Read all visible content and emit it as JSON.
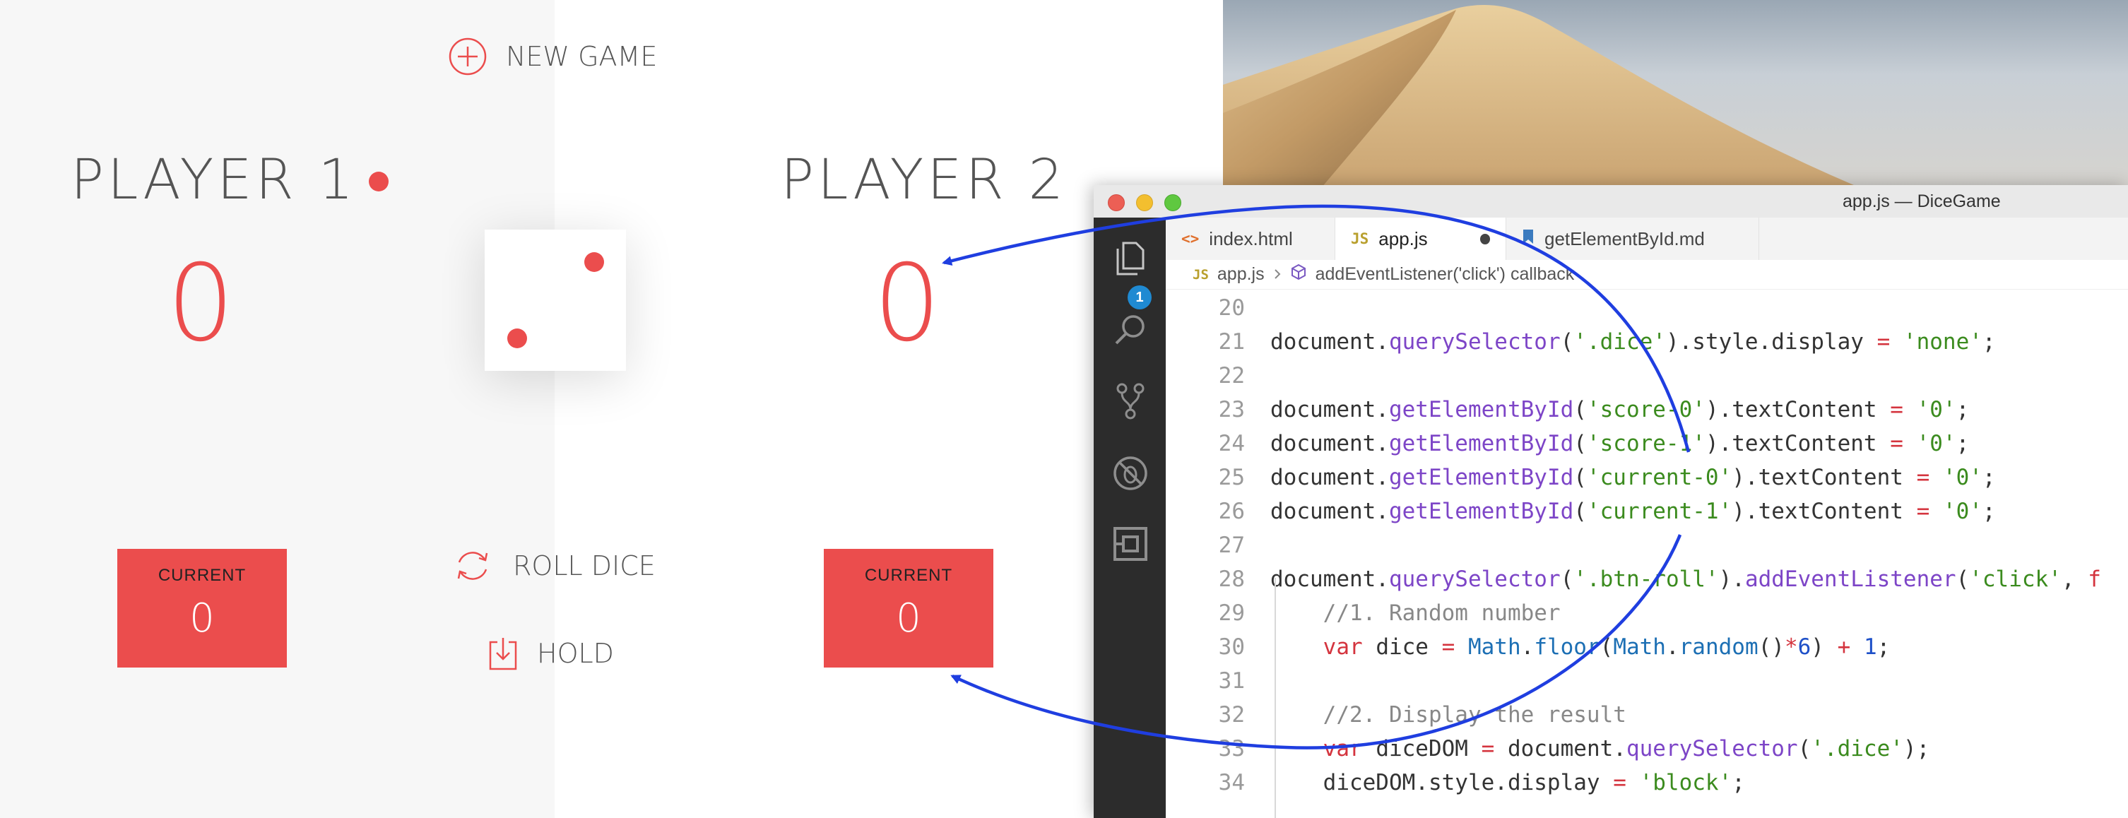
{
  "game": {
    "new_game_label": "NEW GAME",
    "players": [
      {
        "name": "PLAYER 1",
        "score": "0",
        "current_label": "CURRENT",
        "current_value": "0",
        "active": true
      },
      {
        "name": "PLAYER 2",
        "score": "0",
        "current_label": "CURRENT",
        "current_value": "0",
        "active": false
      }
    ],
    "roll_label": "ROLL DICE",
    "hold_label": "HOLD",
    "dice_value": 2,
    "accent_color": "#eb4d4d"
  },
  "editor": {
    "window_title": "app.js — DiceGame",
    "explorer_badge": "1",
    "tabs": [
      {
        "icon": "<>",
        "label": "index.html"
      },
      {
        "icon": "JS",
        "label": "app.js",
        "modified": true
      },
      {
        "icon": "markdown-icon",
        "label": "getElementById.md"
      }
    ],
    "breadcrumb": {
      "file_icon": "JS",
      "file": "app.js",
      "symbol": "addEventListener('click') callback"
    },
    "code_lines": [
      {
        "num": "20",
        "tokens": []
      },
      {
        "num": "21",
        "tokens": [
          {
            "t": "document.",
            "c": ""
          },
          {
            "t": "querySelector",
            "c": "fn"
          },
          {
            "t": "(",
            "c": ""
          },
          {
            "t": "'.dice'",
            "c": "str"
          },
          {
            "t": ").style.display ",
            "c": ""
          },
          {
            "t": "=",
            "c": "kw"
          },
          {
            "t": " ",
            "c": ""
          },
          {
            "t": "'none'",
            "c": "str"
          },
          {
            "t": ";",
            "c": ""
          }
        ]
      },
      {
        "num": "22",
        "tokens": []
      },
      {
        "num": "23",
        "tokens": [
          {
            "t": "document.",
            "c": ""
          },
          {
            "t": "getElementById",
            "c": "fn"
          },
          {
            "t": "(",
            "c": ""
          },
          {
            "t": "'score-0'",
            "c": "str"
          },
          {
            "t": ").textContent ",
            "c": ""
          },
          {
            "t": "=",
            "c": "kw"
          },
          {
            "t": " ",
            "c": ""
          },
          {
            "t": "'0'",
            "c": "str"
          },
          {
            "t": ";",
            "c": ""
          }
        ]
      },
      {
        "num": "24",
        "tokens": [
          {
            "t": "document.",
            "c": ""
          },
          {
            "t": "getElementById",
            "c": "fn"
          },
          {
            "t": "(",
            "c": ""
          },
          {
            "t": "'score-1'",
            "c": "str"
          },
          {
            "t": ").textContent ",
            "c": ""
          },
          {
            "t": "=",
            "c": "kw"
          },
          {
            "t": " ",
            "c": ""
          },
          {
            "t": "'0'",
            "c": "str"
          },
          {
            "t": ";",
            "c": ""
          }
        ]
      },
      {
        "num": "25",
        "tokens": [
          {
            "t": "document.",
            "c": ""
          },
          {
            "t": "getElementById",
            "c": "fn"
          },
          {
            "t": "(",
            "c": ""
          },
          {
            "t": "'current-0'",
            "c": "str"
          },
          {
            "t": ").textContent ",
            "c": ""
          },
          {
            "t": "=",
            "c": "kw"
          },
          {
            "t": " ",
            "c": ""
          },
          {
            "t": "'0'",
            "c": "str"
          },
          {
            "t": ";",
            "c": ""
          }
        ]
      },
      {
        "num": "26",
        "tokens": [
          {
            "t": "document.",
            "c": ""
          },
          {
            "t": "getElementById",
            "c": "fn"
          },
          {
            "t": "(",
            "c": ""
          },
          {
            "t": "'current-1'",
            "c": "str"
          },
          {
            "t": ").textContent ",
            "c": ""
          },
          {
            "t": "=",
            "c": "kw"
          },
          {
            "t": " ",
            "c": ""
          },
          {
            "t": "'0'",
            "c": "str"
          },
          {
            "t": ";",
            "c": ""
          }
        ]
      },
      {
        "num": "27",
        "tokens": []
      },
      {
        "num": "28",
        "tokens": [
          {
            "t": "document.",
            "c": ""
          },
          {
            "t": "querySelector",
            "c": "fn"
          },
          {
            "t": "(",
            "c": ""
          },
          {
            "t": "'.btn-roll'",
            "c": "str"
          },
          {
            "t": ").",
            "c": ""
          },
          {
            "t": "addEventListener",
            "c": "fn"
          },
          {
            "t": "(",
            "c": ""
          },
          {
            "t": "'click'",
            "c": "str"
          },
          {
            "t": ", ",
            "c": ""
          },
          {
            "t": "f",
            "c": "kw"
          }
        ]
      },
      {
        "num": "29",
        "tokens": [
          {
            "t": "    ",
            "c": ""
          },
          {
            "t": "//1. Random number",
            "c": "com"
          }
        ]
      },
      {
        "num": "30",
        "tokens": [
          {
            "t": "    ",
            "c": ""
          },
          {
            "t": "var",
            "c": "kw"
          },
          {
            "t": " dice ",
            "c": ""
          },
          {
            "t": "=",
            "c": "kw"
          },
          {
            "t": " ",
            "c": ""
          },
          {
            "t": "Math",
            "c": "cls"
          },
          {
            "t": ".",
            "c": ""
          },
          {
            "t": "floor",
            "c": "cls"
          },
          {
            "t": "(",
            "c": ""
          },
          {
            "t": "Math",
            "c": "cls"
          },
          {
            "t": ".",
            "c": ""
          },
          {
            "t": "random",
            "c": "cls"
          },
          {
            "t": "()",
            "c": ""
          },
          {
            "t": "*",
            "c": "kw"
          },
          {
            "t": "6",
            "c": "num"
          },
          {
            "t": ") ",
            "c": ""
          },
          {
            "t": "+",
            "c": "kw"
          },
          {
            "t": " ",
            "c": ""
          },
          {
            "t": "1",
            "c": "num"
          },
          {
            "t": ";",
            "c": ""
          }
        ]
      },
      {
        "num": "31",
        "tokens": []
      },
      {
        "num": "32",
        "tokens": [
          {
            "t": "    ",
            "c": ""
          },
          {
            "t": "//2. Display the result",
            "c": "com"
          }
        ]
      },
      {
        "num": "33",
        "tokens": [
          {
            "t": "    ",
            "c": ""
          },
          {
            "t": "var",
            "c": "kw"
          },
          {
            "t": " diceDOM ",
            "c": ""
          },
          {
            "t": "=",
            "c": "kw"
          },
          {
            "t": " document.",
            "c": ""
          },
          {
            "t": "querySelector",
            "c": "fn"
          },
          {
            "t": "(",
            "c": ""
          },
          {
            "t": "'.dice'",
            "c": "str"
          },
          {
            "t": ");",
            "c": ""
          }
        ]
      },
      {
        "num": "34",
        "tokens": [
          {
            "t": "    diceDOM.style.display ",
            "c": ""
          },
          {
            "t": "=",
            "c": "kw"
          },
          {
            "t": " ",
            "c": ""
          },
          {
            "t": "'block'",
            "c": "str"
          },
          {
            "t": ";",
            "c": ""
          }
        ]
      }
    ]
  },
  "annotation_color": "#1f3ee0",
  "icons": [
    "plus-circle-icon",
    "refresh-icon",
    "download-icon",
    "files-icon",
    "search-icon",
    "source-control-icon",
    "debug-icon",
    "extensions-icon",
    "html-icon",
    "js-icon",
    "markdown-icon",
    "cube-icon",
    "chevron-right-icon"
  ]
}
